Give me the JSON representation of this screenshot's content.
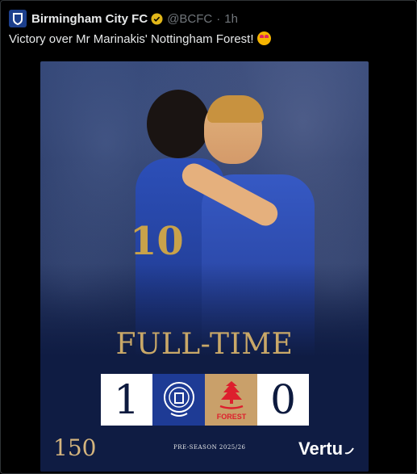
{
  "account": {
    "name": "Birmingham City FC",
    "handle": "@BCFC",
    "separator": "·",
    "time": "1h",
    "verified_icon": "verified-badge-icon",
    "avatar_icon": "club-crest-icon"
  },
  "tweet": {
    "text": "Victory over Mr Marinakis' Nottingham Forest!",
    "emoji": "star-struck-emoji"
  },
  "media": {
    "headline": "FULL-TIME",
    "player_number": "10",
    "home_score": "1",
    "away_score": "0",
    "home_crest_icon": "birmingham-crest-icon",
    "away_crest_icon": "nottingham-forest-crest-icon",
    "away_crest_text": "FOREST",
    "anniversary": "150",
    "season": "PRE-SEASON 2025/26",
    "sponsor": "Vertu",
    "colors": {
      "brand_blue": "#1e3b95",
      "gold": "#c9a868",
      "forest_tan": "#c9a06a",
      "forest_red": "#dd1f2d"
    }
  }
}
